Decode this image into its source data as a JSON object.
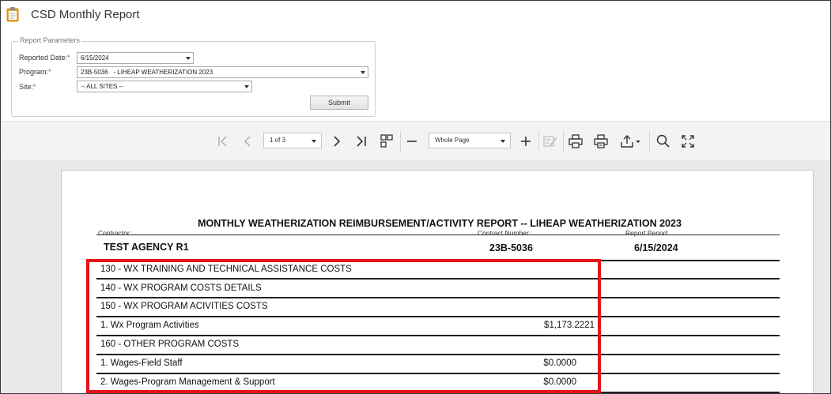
{
  "app": {
    "title": "CSD Monthly Report"
  },
  "parameters": {
    "legend": "Report Parameters",
    "required_mark": "*",
    "reported_date": {
      "label": "Reported Date:",
      "value": "6/15/2024"
    },
    "program": {
      "label": "Program:",
      "value": "23B-5036   - LIHEAP WEATHERIZATION 2023"
    },
    "site": {
      "label": "Site:",
      "value": "-- ALL SITES --"
    },
    "submit_label": "Submit"
  },
  "toolbar": {
    "page_select": "1 of 3",
    "zoom_select": "Whole Page"
  },
  "report": {
    "title": "MONTHLY WEATHERIZATION REIMBURSEMENT/ACTIVITY REPORT -- LIHEAP WEATHERIZATION 2023",
    "contractor_label": "Contractor:",
    "contractor": "TEST AGENCY R1",
    "contract_number_label": "Contract Number:",
    "contract_number": "23B-5036",
    "report_period_label": "Report Period:",
    "report_period": "6/15/2024",
    "rows": [
      {
        "text": "130 - WX TRAINING AND TECHNICAL ASSISTANCE COSTS",
        "amount": ""
      },
      {
        "text": "140 - WX PROGRAM COSTS DETAILS",
        "amount": ""
      },
      {
        "text": "150 - WX PROGRAM ACIVITIES COSTS",
        "amount": ""
      },
      {
        "text": "1. Wx Program Activities",
        "amount": "$1,173.2221"
      },
      {
        "text": "160 - OTHER PROGRAM COSTS",
        "amount": ""
      },
      {
        "text": "1. Wages-Field Staff",
        "amount": "$0.0000"
      },
      {
        "text": "2. Wages-Program Management & Support",
        "amount": "$0.0000"
      }
    ]
  }
}
